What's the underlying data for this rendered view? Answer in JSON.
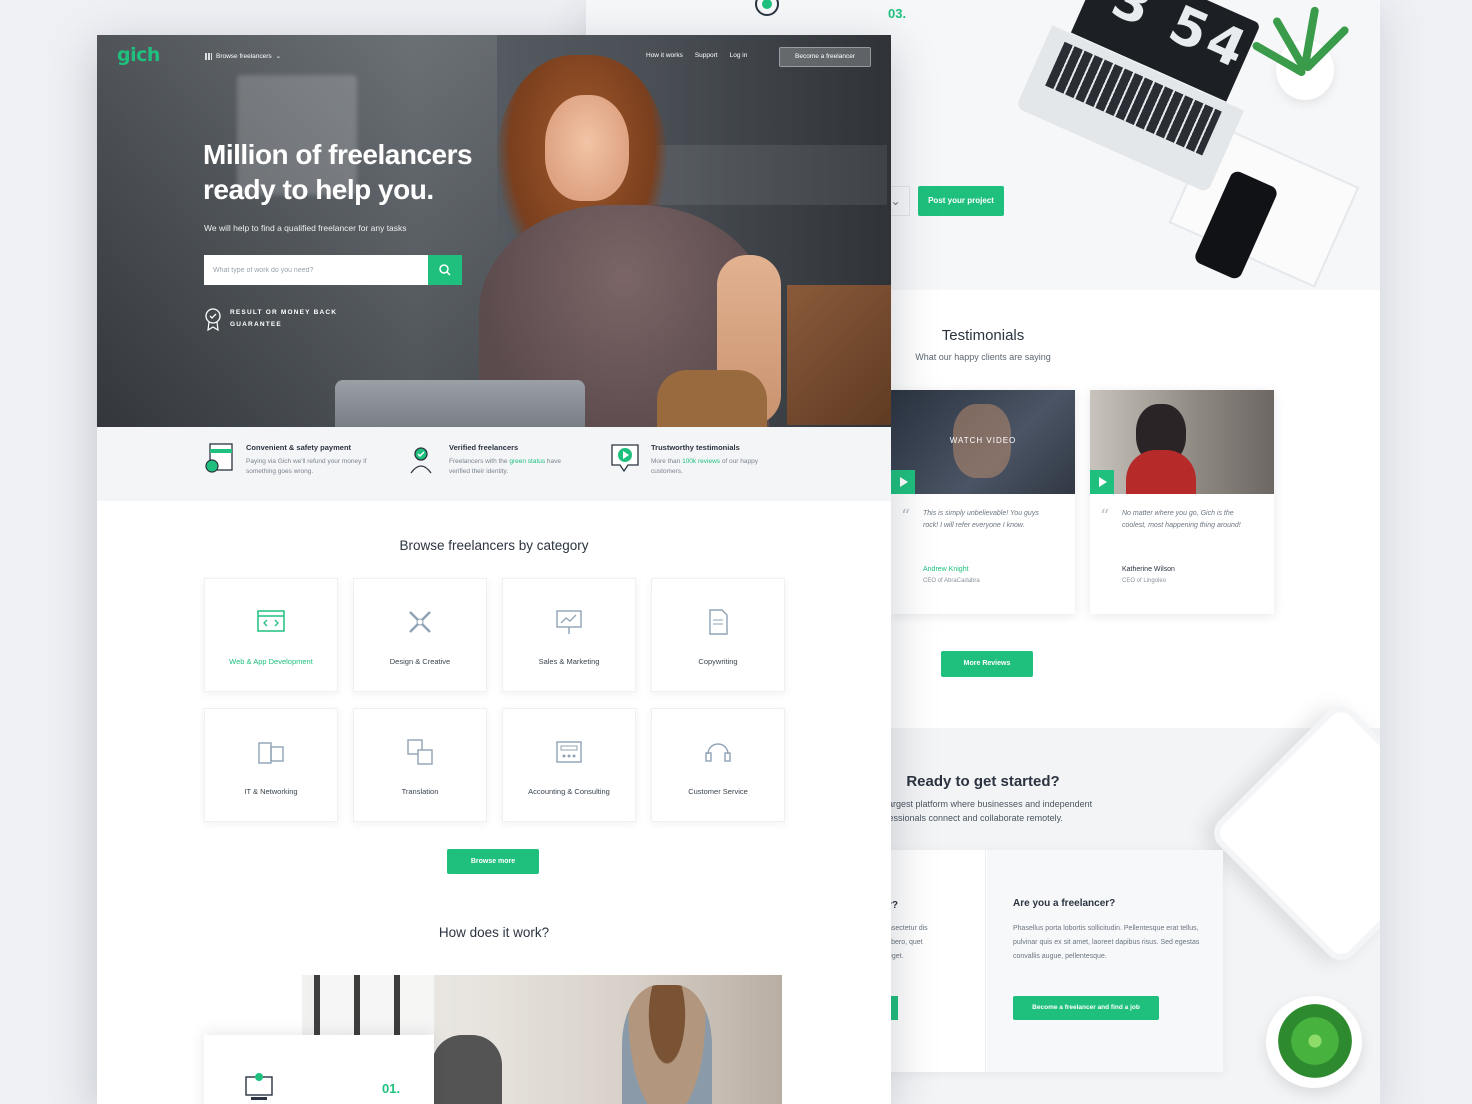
{
  "brand": {
    "logo": "gich",
    "accent": "#1fc07e"
  },
  "nav": {
    "browse": "Browse freelancers",
    "links": [
      "How it works",
      "Support",
      "Log in"
    ],
    "cta": "Become a freelancer"
  },
  "hero": {
    "title": "Million of freelancers ready to help you.",
    "subtitle": "We will help to find a qualified freelancer for any tasks",
    "search_placeholder": "What type of work do you need?",
    "guarantee": "RESULT OR MONEY BACK GUARANTEE"
  },
  "features": [
    {
      "icon": "payment-card-icon",
      "title": "Convenient & safety payment",
      "text": "Paying via Gich we'll refund your money if something goes wrong."
    },
    {
      "icon": "verified-user-icon",
      "title": "Verified freelancers",
      "text_a": "Freelancers with the ",
      "text_highlight": "green status",
      "text_b": " have verified their identity."
    },
    {
      "icon": "testimonial-play-icon",
      "title": "Trustworthy testimonials",
      "text_a": "More than ",
      "text_highlight": "100k reviews",
      "text_b": " of our happy customers."
    }
  ],
  "categories": {
    "title": "Browse freelancers by category",
    "items": [
      {
        "label": "Web & App Development",
        "icon": "code-window-icon",
        "active": true
      },
      {
        "label": "Design & Creative",
        "icon": "pencil-ruler-icon"
      },
      {
        "label": "Sales & Marketing",
        "icon": "presentation-chart-icon"
      },
      {
        "label": "Copywriting",
        "icon": "document-icon"
      },
      {
        "label": "IT & Networking",
        "icon": "devices-icon"
      },
      {
        "label": "Translation",
        "icon": "translate-icon"
      },
      {
        "label": "Accounting & Consulting",
        "icon": "calculator-icon"
      },
      {
        "label": "Customer Service",
        "icon": "headset-icon"
      }
    ],
    "more": "Browse more"
  },
  "how": {
    "title": "How does it work?",
    "step1": "01.",
    "step3": "03."
  },
  "post": {
    "button": "Post your project"
  },
  "laptop_clock": "3 54",
  "testimonials": {
    "title": "Testimonials",
    "subtitle": "What our happy clients are saying",
    "watch": "WATCH VIDEO",
    "items": [
      {
        "quote": "This is simply unbelievable! You guys rock! I will refer everyone I know.",
        "name": "Andrew Knight",
        "role": "CEO of AbraCadabra"
      },
      {
        "quote": "No matter where you go, Gich is the coolest, most happening thing around!",
        "name": "Katherine Wilson",
        "role": "CEO of Lingoleo"
      }
    ],
    "more": "More Reviews"
  },
  "ready": {
    "title": "Ready to get started?",
    "desc_line1": "largest platform where businesses and independent",
    "desc_line2": "fessionals connect and collaborate remotely.",
    "client_heading": "r?",
    "client_text": "nsectetur dis libero, quet eget.",
    "freelancer_heading": "Are you a freelancer?",
    "freelancer_text": "Phasellus porta lobortis sollicitudin. Pellentesque erat tellus, pulvinar quis ex sit amet, laoreet dapibus risus. Sed egestas convallis augue, pellentesque.",
    "freelancer_button": "Become a freelancer and find a job"
  }
}
